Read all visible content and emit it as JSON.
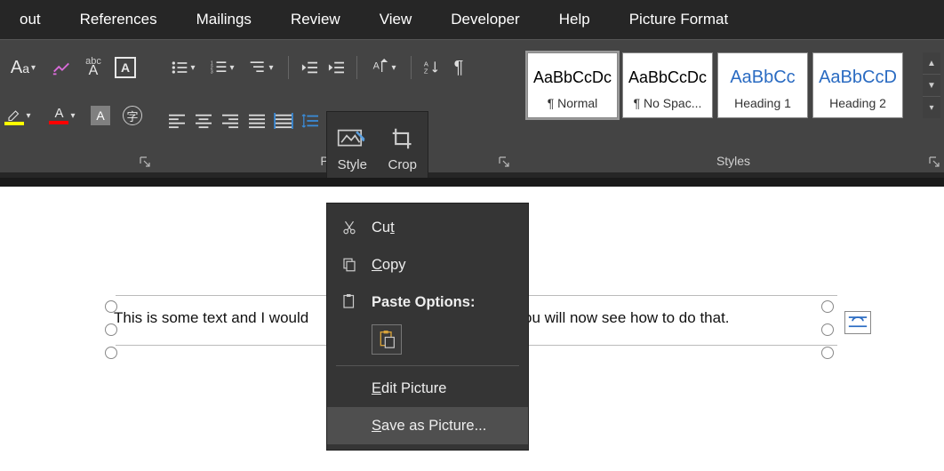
{
  "tabs": {
    "layout": "out",
    "references": "References",
    "mailings": "Mailings",
    "review": "Review",
    "view": "View",
    "developer": "Developer",
    "help": "Help",
    "picture_format": "Picture Format"
  },
  "ribbon": {
    "paragraph_label": "Parag",
    "styles_label": "Styles"
  },
  "styles_gallery": [
    {
      "preview": "AaBbCcDc",
      "name": "¶ Normal",
      "blue": false,
      "selected": true
    },
    {
      "preview": "AaBbCcDc",
      "name": "¶ No Spac...",
      "blue": false,
      "selected": false
    },
    {
      "preview": "AaBbCc",
      "name": "Heading 1",
      "blue": true,
      "selected": false
    },
    {
      "preview": "AaBbCcD",
      "name": "Heading 2",
      "blue": true,
      "selected": false
    }
  ],
  "mini_toolbar": {
    "style": "Style",
    "crop": "Crop"
  },
  "context_menu": {
    "cut": "Cut",
    "copy": "Copy",
    "paste_options": "Paste Options:",
    "edit_picture": "Edit Picture",
    "save_as_picture": "Save as Picture..."
  },
  "document": {
    "text_left": "This is some text and I would",
    "text_right": "You will now see how to do that."
  }
}
